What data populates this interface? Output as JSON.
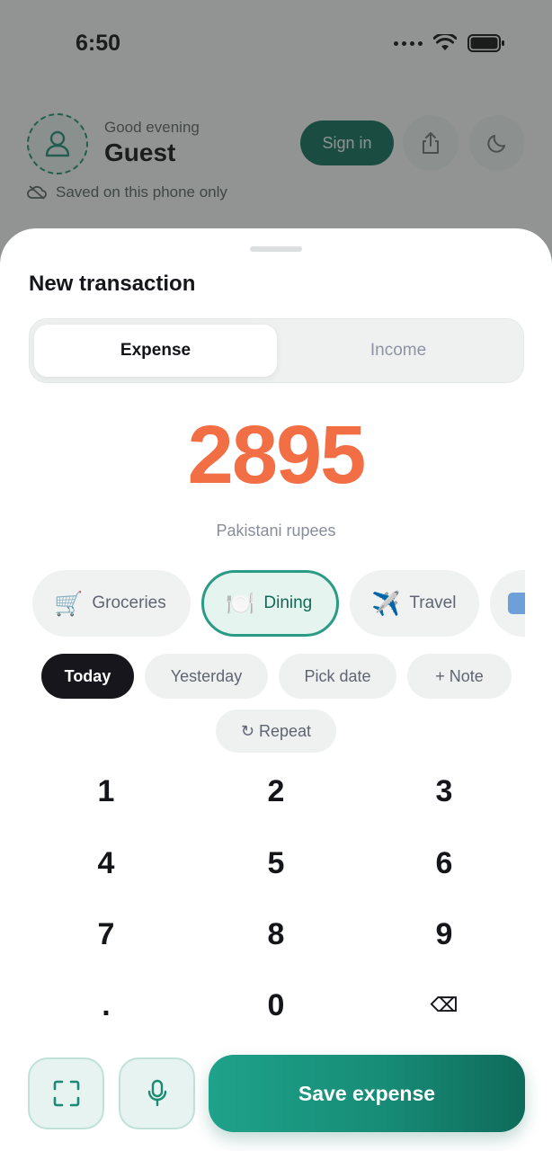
{
  "status_bar": {
    "time": "6:50"
  },
  "header": {
    "greeting": "Good evening",
    "user_name": "Guest",
    "saved_note": "Saved on this phone only",
    "sign_in_label": "Sign in"
  },
  "sheet": {
    "title": "New transaction",
    "tabs": [
      {
        "label": "Expense",
        "active": true
      },
      {
        "label": "Income",
        "active": false
      }
    ],
    "amount": "2895",
    "currency_label": "Pakistani rupees",
    "categories": [
      {
        "emoji": "🛒",
        "label": "Groceries",
        "selected": false
      },
      {
        "emoji": "🍽️",
        "label": "Dining",
        "selected": true
      },
      {
        "emoji": "✈️",
        "label": "Travel",
        "selected": false
      }
    ],
    "date_options": [
      {
        "label": "Today",
        "selected": true
      },
      {
        "label": "Yesterday",
        "selected": false
      },
      {
        "label": "Pick date",
        "selected": false
      }
    ],
    "note_label": "+ Note",
    "repeat_label": "↻ Repeat",
    "keypad": [
      "1",
      "2",
      "3",
      "4",
      "5",
      "6",
      "7",
      "8",
      "9",
      ".",
      "0",
      "⌫"
    ],
    "save_label": "Save expense"
  },
  "colors": {
    "accent": "#1a9a82",
    "amount": "#f26e44",
    "dark_pill": "#16161c"
  }
}
